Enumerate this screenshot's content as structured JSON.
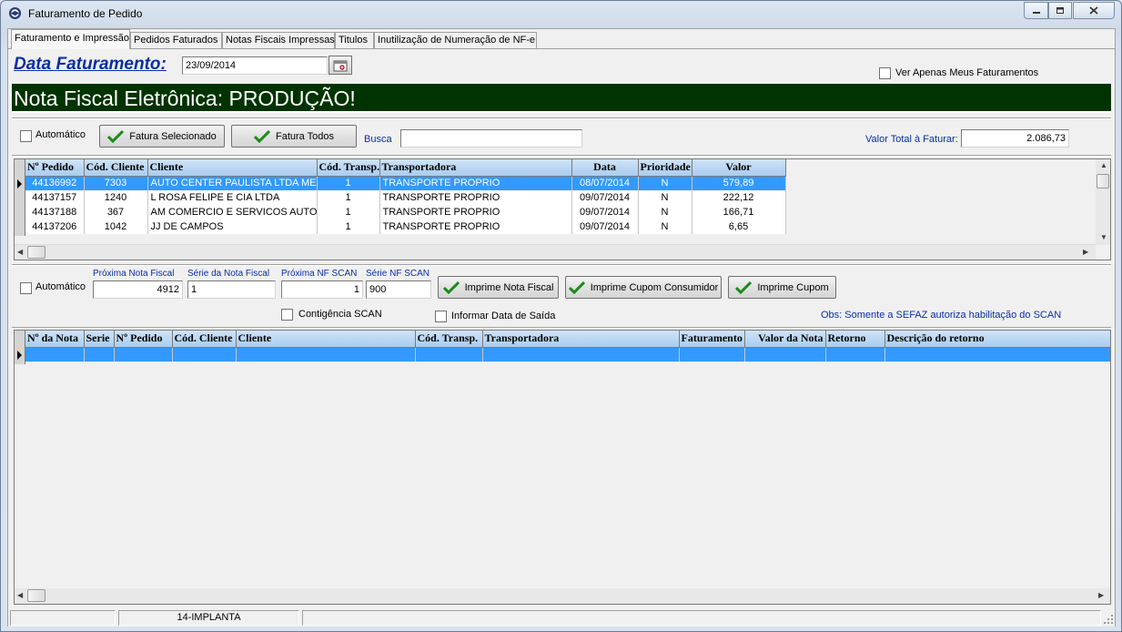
{
  "window": {
    "title": "Faturamento de Pedido"
  },
  "tabs": [
    {
      "label": "Faturamento e Impressão"
    },
    {
      "label": "Pedidos Faturados"
    },
    {
      "label": "Notas Fiscais Impressas"
    },
    {
      "label": "Titulos"
    },
    {
      "label": "Inutilização de Numeração de NF-e"
    }
  ],
  "header": {
    "date_label": "Data Faturamento:",
    "date_value": "23/09/2014",
    "only_mine_label": "Ver Apenas Meus Faturamentos",
    "banner": "Nota Fiscal Eletrônica: PRODUÇÃO!",
    "banner_color": "#003300"
  },
  "toolbar1": {
    "auto_label": "Automático",
    "fatura_sel": "Fatura Selecionado",
    "fatura_todos": "Fatura Todos",
    "busca_label": "Busca",
    "busca_value": "",
    "total_label": "Valor Total à Faturar:",
    "total_value": "2.086,73"
  },
  "orders": {
    "columns": [
      "Nº Pedido",
      "Cód. Cliente",
      "Cliente",
      "Cód. Transp.",
      "Transportadora",
      "Data",
      "Prioridade",
      "Valor"
    ],
    "rows": [
      [
        "44136992",
        "7303",
        "AUTO CENTER PAULISTA LTDA ME",
        "1",
        "TRANSPORTE PROPRIO",
        "08/07/2014",
        "N",
        "579,89"
      ],
      [
        "44137157",
        "1240",
        "L ROSA FELIPE E CIA LTDA",
        "1",
        "TRANSPORTE PROPRIO",
        "09/07/2014",
        "N",
        "222,12"
      ],
      [
        "44137188",
        "367",
        "AM COMERCIO E SERVICOS AUTOM",
        "1",
        "TRANSPORTE PROPRIO",
        "09/07/2014",
        "N",
        "166,71"
      ],
      [
        "44137206",
        "1042",
        "JJ DE CAMPOS",
        "1",
        "TRANSPORTE PROPRIO",
        "09/07/2014",
        "N",
        "6,65"
      ]
    ]
  },
  "toolbar2": {
    "auto_label": "Automático",
    "prox_nf_label": "Próxima Nota Fiscal",
    "prox_nf_value": "4912",
    "serie_label": "Série da Nota Fiscal",
    "serie_value": "1",
    "prox_scan_label": "Próxima NF SCAN",
    "prox_scan_value": "1",
    "serie_scan_label": "Série NF SCAN",
    "serie_scan_value": "900",
    "imprime_nf": "Imprime Nota Fiscal",
    "imprime_cupom_consumidor": "Imprime Cupom Consumidor",
    "imprime_cupom": "Imprime Cupom",
    "contingencia_label": "Contigência SCAN",
    "informar_data_label": "Informar Data de Saída",
    "obs": "Obs: Somente a SEFAZ autoriza habilitação do SCAN"
  },
  "notes": {
    "columns": [
      "Nº da Nota",
      "Serie",
      "Nº Pedido",
      "Cód. Cliente",
      "Cliente",
      "Cód. Transp.",
      "Transportadora",
      "Faturamento",
      "Valor da Nota",
      "Retorno",
      "Descrição do retorno"
    ]
  },
  "status": {
    "panel2": "14-IMPLANTA"
  },
  "colors": {
    "selection": "#3399ff",
    "header_grad": "#a9cdef",
    "label_blue": "#0b2ea3"
  },
  "icons": [
    "app-icon",
    "calendar-icon",
    "checkmark-icon",
    "minimize-icon",
    "maximize-icon",
    "close-icon"
  ]
}
